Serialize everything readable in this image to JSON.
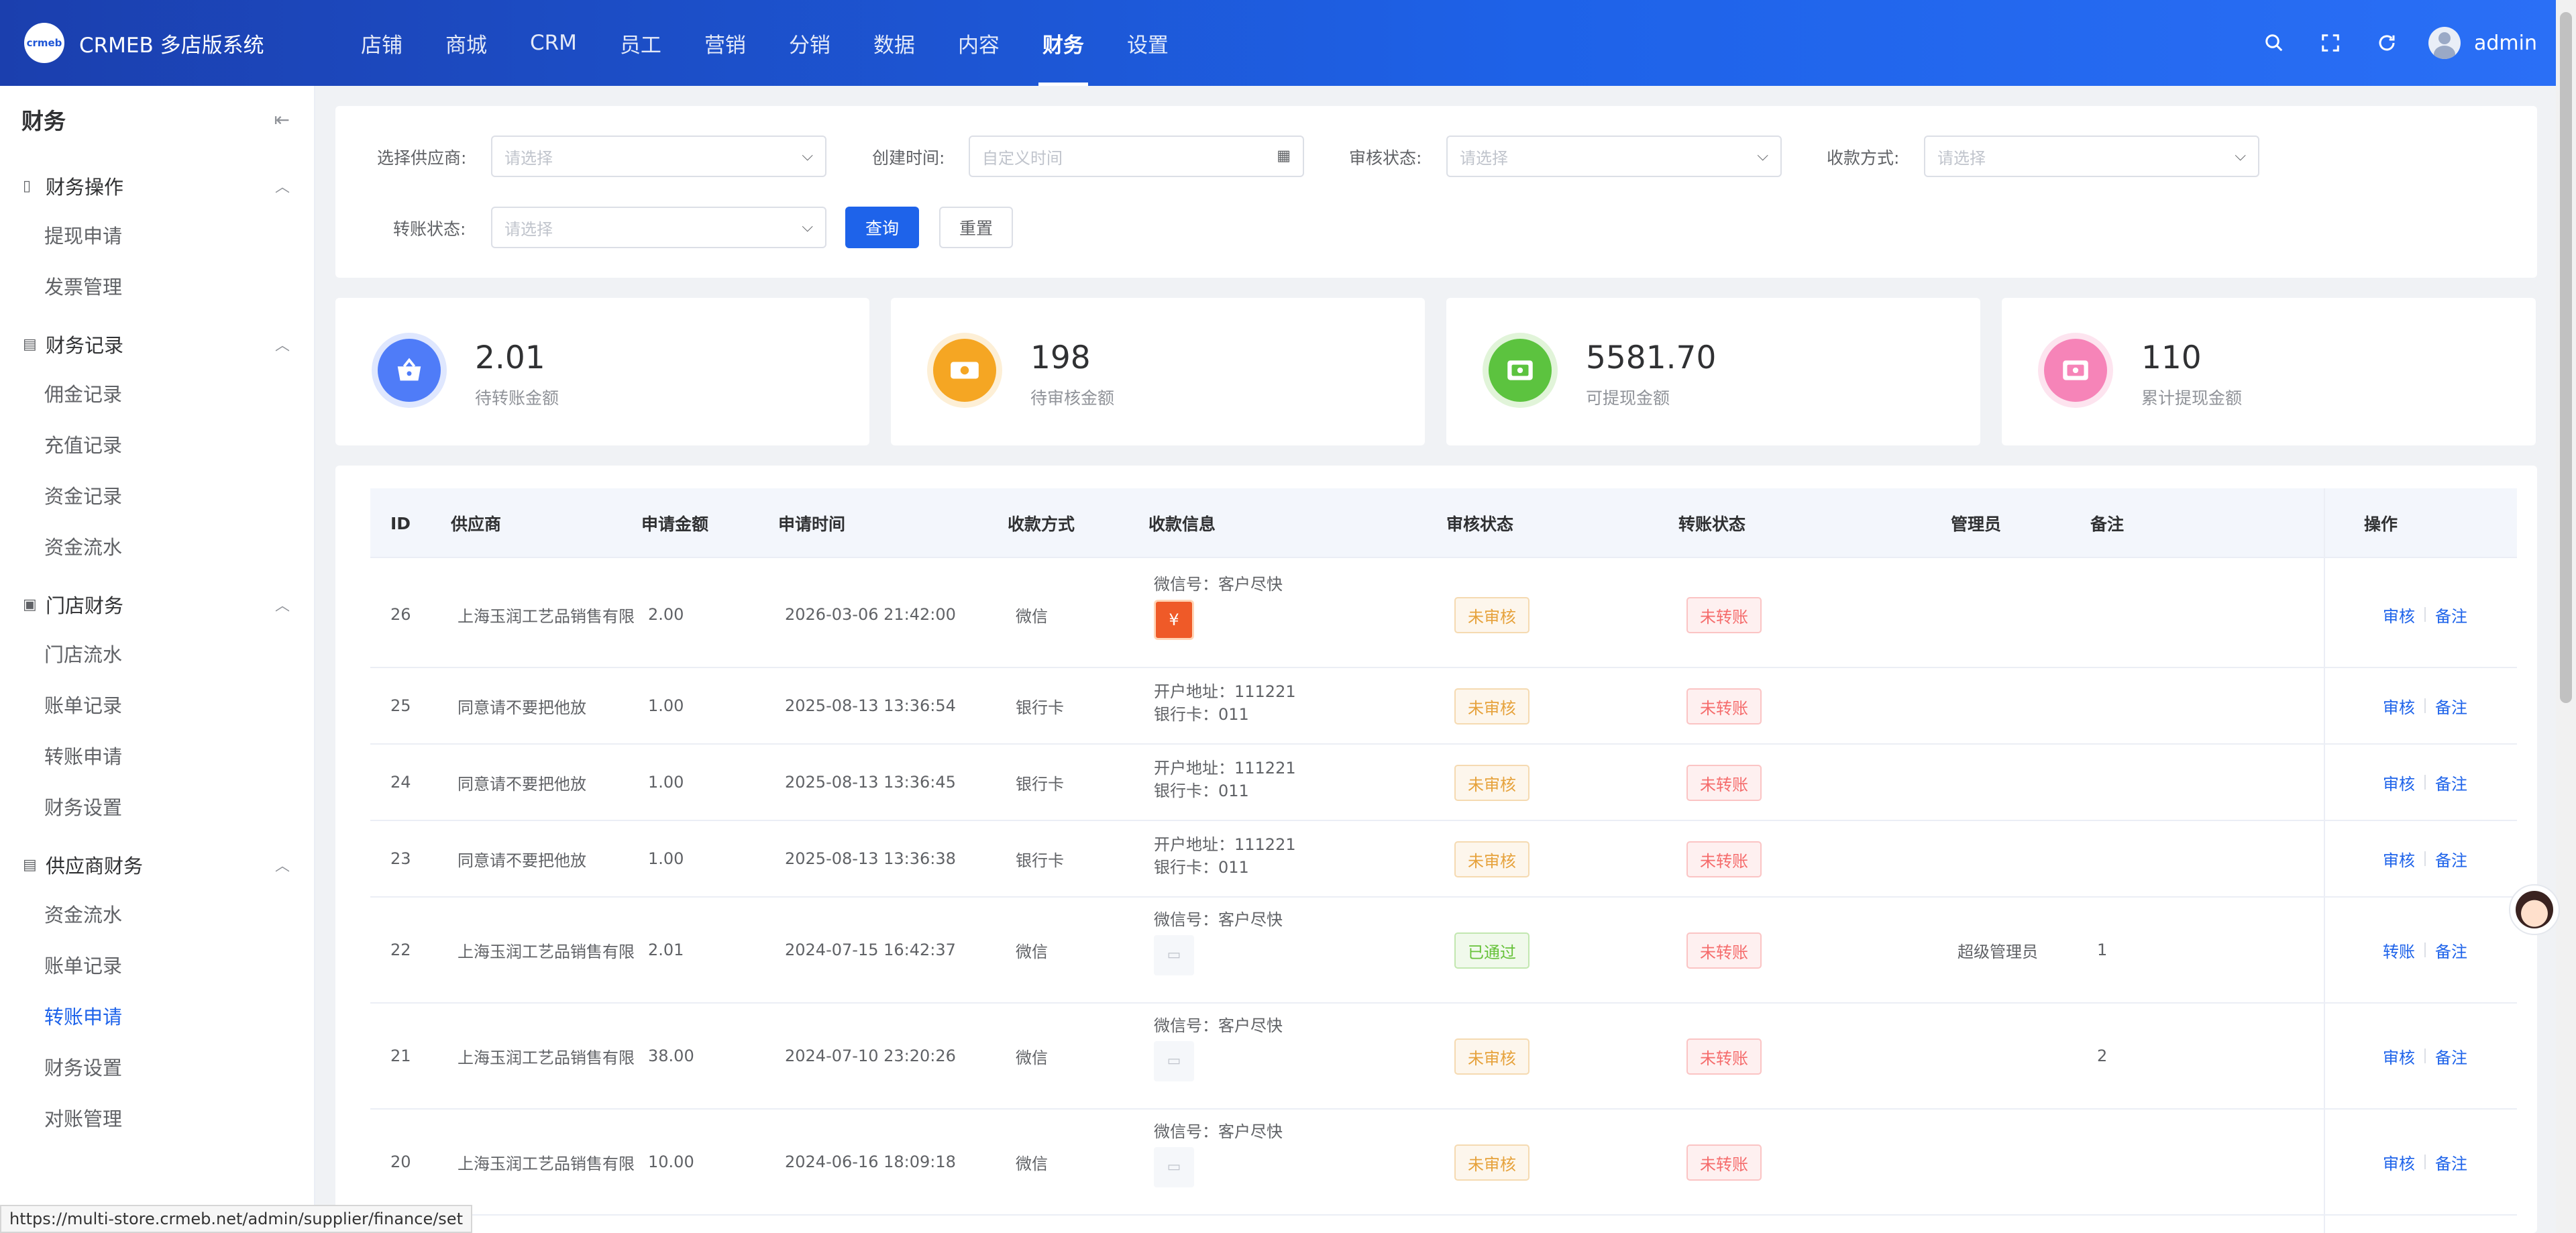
{
  "header": {
    "logo_badge": "crmeb",
    "brand": "CRMEB 多店版系统",
    "nav": [
      "店铺",
      "商城",
      "CRM",
      "员工",
      "营销",
      "分销",
      "数据",
      "内容",
      "财务",
      "设置"
    ],
    "active_nav": "财务",
    "user": "admin"
  },
  "sidebar": {
    "title": "财务",
    "groups": [
      {
        "label": "财务操作",
        "icon": "▯",
        "items": [
          "提现申请",
          "发票管理"
        ]
      },
      {
        "label": "财务记录",
        "icon": "▤",
        "items": [
          "佣金记录",
          "充值记录",
          "资金记录",
          "资金流水"
        ]
      },
      {
        "label": "门店财务",
        "icon": "▣",
        "items": [
          "门店流水",
          "账单记录",
          "转账申请",
          "财务设置"
        ]
      },
      {
        "label": "供应商财务",
        "icon": "▤",
        "items": [
          "资金流水",
          "账单记录",
          "转账申请",
          "财务设置",
          "对账管理"
        ]
      }
    ],
    "active_item": "转账申请"
  },
  "filters": {
    "supplier_label": "选择供应商:",
    "supplier_placeholder": "请选择",
    "time_label": "创建时间:",
    "time_placeholder": "自定义时间",
    "audit_label": "审核状态:",
    "audit_placeholder": "请选择",
    "method_label": "收款方式:",
    "method_placeholder": "请选择",
    "transfer_label": "转账状态:",
    "transfer_placeholder": "请选择",
    "query_button": "查询",
    "reset_button": "重置"
  },
  "stats": [
    {
      "value": "2.01",
      "label": "待转账金额",
      "color": "#4f7cf8",
      "ring": "#dfe7fe",
      "icon": "basket-icon"
    },
    {
      "value": "198",
      "label": "待审核金额",
      "color": "#f5a623",
      "ring": "#fdefd6",
      "icon": "money-icon"
    },
    {
      "value": "5581.70",
      "label": "可提现金额",
      "color": "#5cc33f",
      "ring": "#e1f4d9",
      "icon": "cash-icon"
    },
    {
      "value": "110",
      "label": "累计提现金额",
      "color": "#f684b8",
      "ring": "#fde4ef",
      "icon": "cash-icon"
    }
  ],
  "table": {
    "headers": [
      "ID",
      "供应商",
      "申请金额",
      "申请时间",
      "收款方式",
      "收款信息",
      "审核状态",
      "转账状态",
      "管理员",
      "备注",
      "操作"
    ],
    "rows": [
      {
        "id": "26",
        "supplier": "上海玉润工艺品销售有限",
        "amount": "2.00",
        "time": "2026-03-06 21:42:00",
        "method": "微信",
        "info1": "微信号：客户尽快",
        "info2": "",
        "img": "red",
        "audit": "未审核",
        "audit_type": "warn",
        "transfer": "未转账",
        "admin": "",
        "remark": "",
        "op1": "审核",
        "op2": "备注"
      },
      {
        "id": "25",
        "supplier": "同意请不要把他放",
        "amount": "1.00",
        "time": "2025-08-13 13:36:54",
        "method": "银行卡",
        "info1": "开户地址：111221",
        "info2": "银行卡：011",
        "img": "",
        "audit": "未审核",
        "audit_type": "warn",
        "transfer": "未转账",
        "admin": "",
        "remark": "",
        "op1": "审核",
        "op2": "备注"
      },
      {
        "id": "24",
        "supplier": "同意请不要把他放",
        "amount": "1.00",
        "time": "2025-08-13 13:36:45",
        "method": "银行卡",
        "info1": "开户地址：111221",
        "info2": "银行卡：011",
        "img": "",
        "audit": "未审核",
        "audit_type": "warn",
        "transfer": "未转账",
        "admin": "",
        "remark": "",
        "op1": "审核",
        "op2": "备注"
      },
      {
        "id": "23",
        "supplier": "同意请不要把他放",
        "amount": "1.00",
        "time": "2025-08-13 13:36:38",
        "method": "银行卡",
        "info1": "开户地址：111221",
        "info2": "银行卡：011",
        "img": "",
        "audit": "未审核",
        "audit_type": "warn",
        "transfer": "未转账",
        "admin": "",
        "remark": "",
        "op1": "审核",
        "op2": "备注"
      },
      {
        "id": "22",
        "supplier": "上海玉润工艺品销售有限",
        "amount": "2.01",
        "time": "2024-07-15 16:42:37",
        "method": "微信",
        "info1": "微信号：客户尽快",
        "info2": "",
        "img": "grey",
        "audit": "已通过",
        "audit_type": "success",
        "transfer": "未转账",
        "admin": "超级管理员",
        "remark": "1",
        "op1": "转账",
        "op2": "备注"
      },
      {
        "id": "21",
        "supplier": "上海玉润工艺品销售有限",
        "amount": "38.00",
        "time": "2024-07-10 23:20:26",
        "method": "微信",
        "info1": "微信号：客户尽快",
        "info2": "",
        "img": "grey",
        "audit": "未审核",
        "audit_type": "warn",
        "transfer": "未转账",
        "admin": "",
        "remark": "2",
        "op1": "审核",
        "op2": "备注"
      },
      {
        "id": "20",
        "supplier": "上海玉润工艺品销售有限",
        "amount": "10.00",
        "time": "2024-06-16 18:09:18",
        "method": "微信",
        "info1": "微信号：客户尽快",
        "info2": "",
        "img": "grey",
        "audit": "未审核",
        "audit_type": "warn",
        "transfer": "未转账",
        "admin": "",
        "remark": "",
        "op1": "审核",
        "op2": "备注"
      }
    ]
  },
  "status_url": "https://multi-store.crmeb.net/admin/supplier/finance/set"
}
